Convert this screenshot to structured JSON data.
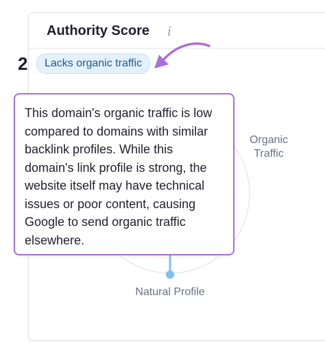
{
  "card": {
    "title": "Authority Score",
    "info_icon": "info-icon"
  },
  "score": {
    "value": "2",
    "badge": "Lacks organic traffic"
  },
  "chart": {
    "organic_label": "Organic Traffic",
    "natural_label": "Natural Profile"
  },
  "tooltip": {
    "text": "This domain's organic traffic is low compared to domains with similar backlink profiles. While this domain's link profile is strong, the website itself may have technical issues or poor content, causing Google to send organic traffic elsewhere."
  },
  "colors": {
    "accent_purple": "#a86fdd",
    "badge_bg": "#e3f1fc",
    "badge_text": "#1a5b91",
    "chart_blue": "#7dc1f0"
  },
  "annotation": {
    "arrow_icon": "curved-arrow-icon"
  }
}
